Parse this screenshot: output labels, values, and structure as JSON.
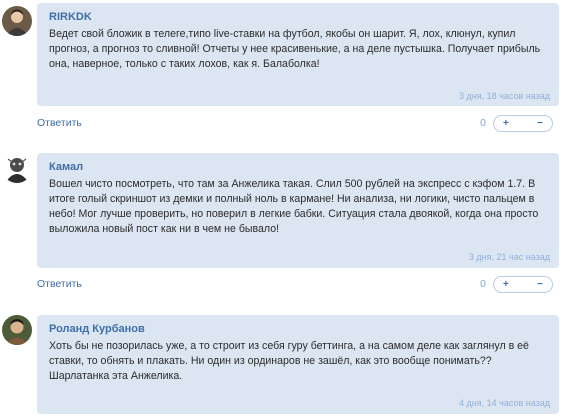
{
  "comments": [
    {
      "author": "RIRKDK",
      "text": "Ведет свой бложик в телеге,типо live-ставки на футбол, якобы он шарит. Я, лох, клюнул, купил прогноз, а прогноз то сливной! Отчеты у нее красивенькие, а на деле пустышка. Получает прибыль она, наверное, только с таких лохов, как я. Балаболка!",
      "time": "3 дня, 18 часов назад",
      "reply_label": "Ответить",
      "score": "0",
      "plus": "+",
      "minus": "−"
    },
    {
      "author": "Камал",
      "text": "Вошел чисто посмотреть, что там за Анжелика такая. Слил 500 рублей на экспресс с кэфом 1.7. В итоге голый скриншот из демки и полный ноль в кармане! Ни анализа, ни логики, чисто пальцем в небо! Мог лучше проверить, но поверил в легкие бабки. Ситуация стала двоякой, когда она просто выложила новый пост как ни в чем не бывало!",
      "time": "3 дня, 21 час назад",
      "reply_label": "Ответить",
      "score": "0",
      "plus": "+",
      "minus": "−"
    },
    {
      "author": "Роланд Курбанов",
      "text": "Хоть бы не позорилась уже, а то строит из себя гуру беттинга, а на самом деле как заглянул в её ставки, то обнять и плакать. Ни один из ординаров не зашёл, как это вообще понимать?? Шарлатанка эта Анжелика.",
      "time": "4 дня, 14 часов назад"
    }
  ]
}
